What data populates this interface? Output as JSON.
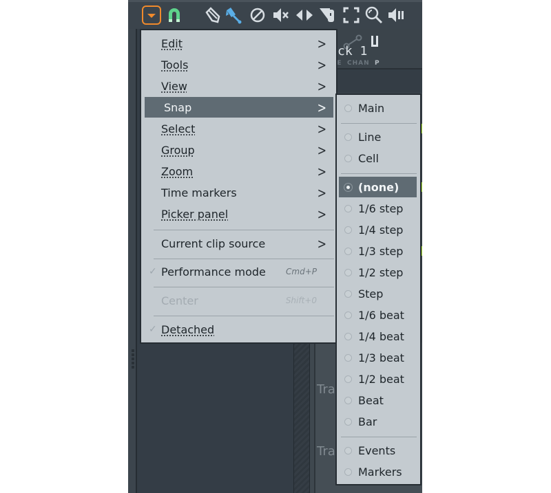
{
  "toolbar": {
    "icons": [
      {
        "name": "menu-dropdown-icon",
        "glyph": "▾"
      },
      {
        "name": "magnet-snap-icon",
        "glyph": "∩"
      },
      {
        "name": "pencil-icon",
        "glyph": "✎"
      },
      {
        "name": "paint-brush-icon",
        "glyph": "🖌"
      },
      {
        "name": "delete-icon",
        "glyph": "⊘"
      },
      {
        "name": "mute-icon",
        "glyph": "◀×"
      },
      {
        "name": "slip-icon",
        "glyph": "◀▶"
      },
      {
        "name": "slice-icon",
        "glyph": "◥"
      },
      {
        "name": "select-icon",
        "glyph": "⛶"
      },
      {
        "name": "zoom-icon",
        "glyph": "🔍"
      },
      {
        "name": "playback-icon",
        "glyph": "◀‖"
      }
    ]
  },
  "right_pane": {
    "labels": [
      "NOTE",
      "CHAN",
      "P"
    ],
    "track_title": "ck 1",
    "track_labels": [
      "Tra",
      "Tra"
    ]
  },
  "menu": {
    "items": [
      {
        "label": "Edit",
        "submenu": true
      },
      {
        "label": "Tools",
        "submenu": true
      },
      {
        "label": "View",
        "submenu": true
      },
      {
        "label": "Snap",
        "submenu": true,
        "active": true
      },
      {
        "label": "Select",
        "submenu": true
      },
      {
        "label": "Group",
        "submenu": true
      },
      {
        "label": "Zoom",
        "submenu": true
      },
      {
        "label": "Time markers",
        "submenu": true
      },
      {
        "label": "Picker panel",
        "submenu": true
      },
      {
        "label": "Current clip source",
        "submenu": true
      },
      {
        "label": "Performance mode",
        "shortcut": "Cmd+P",
        "checked": true
      },
      {
        "label": "Center",
        "shortcut": "Shift+0",
        "disabled": true
      },
      {
        "label": "Detached",
        "checked": true
      }
    ],
    "arrow_glyph": ">",
    "check_glyph": "✓"
  },
  "snap_submenu": {
    "items": [
      {
        "label": "Main"
      },
      {
        "label": "Line"
      },
      {
        "label": "Cell"
      },
      {
        "label": "(none)",
        "selected": true
      },
      {
        "label": "1/6 step"
      },
      {
        "label": "1/4 step"
      },
      {
        "label": "1/3 step"
      },
      {
        "label": "1/2 step"
      },
      {
        "label": "Step"
      },
      {
        "label": "1/6 beat"
      },
      {
        "label": "1/4 beat"
      },
      {
        "label": "1/3 beat"
      },
      {
        "label": "1/2 beat"
      },
      {
        "label": "Beat"
      },
      {
        "label": "Bar"
      },
      {
        "label": "Events"
      },
      {
        "label": "Markers"
      }
    ]
  },
  "colors": {
    "accent_orange": "#f08a2c",
    "magnet_green": "#5ed38c",
    "brush_blue": "#5aaee6",
    "menu_bg": "#c4cbd0",
    "highlight": "#5f6b73"
  }
}
